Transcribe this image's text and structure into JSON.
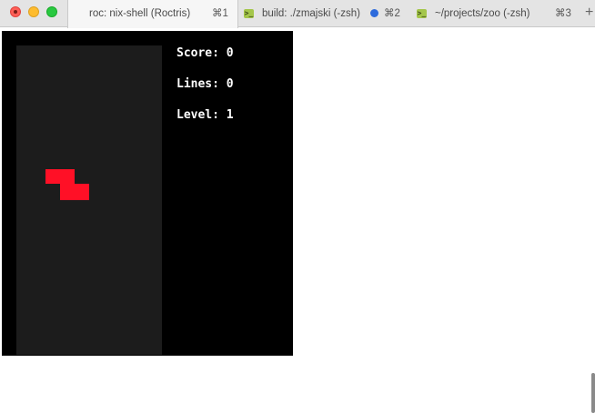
{
  "window": {
    "buttons": [
      "close",
      "minimize",
      "zoom"
    ]
  },
  "tabs": [
    {
      "title": "roc: nix-shell (Roctris)",
      "shortcut": "⌘1",
      "active": true,
      "icon": null
    },
    {
      "title": "build: ./zmajski (-zsh)",
      "shortcut": "⌘2",
      "active": false,
      "icon": "terminal-icon",
      "activity_dot": true
    },
    {
      "title": "~/projects/zoo (-zsh)",
      "shortcut": "⌘3",
      "active": false,
      "icon": "terminal-icon"
    }
  ],
  "new_tab_label": "+",
  "terminal_icon_glyph": ">_",
  "game": {
    "score_text": "Score: 0",
    "lines_text": "Lines: 0",
    "level_text": "Level: 1",
    "score": 0,
    "lines": 0,
    "level": 1,
    "board_color": "#1c1c1c",
    "background_color": "#000000",
    "piece": {
      "type": "Z",
      "color": "#ff1026"
    }
  },
  "colors": {
    "tab_bar": "#e4e4e4",
    "active_tab": "#f6f6f6",
    "activity_dot": "#2d6bdc"
  }
}
